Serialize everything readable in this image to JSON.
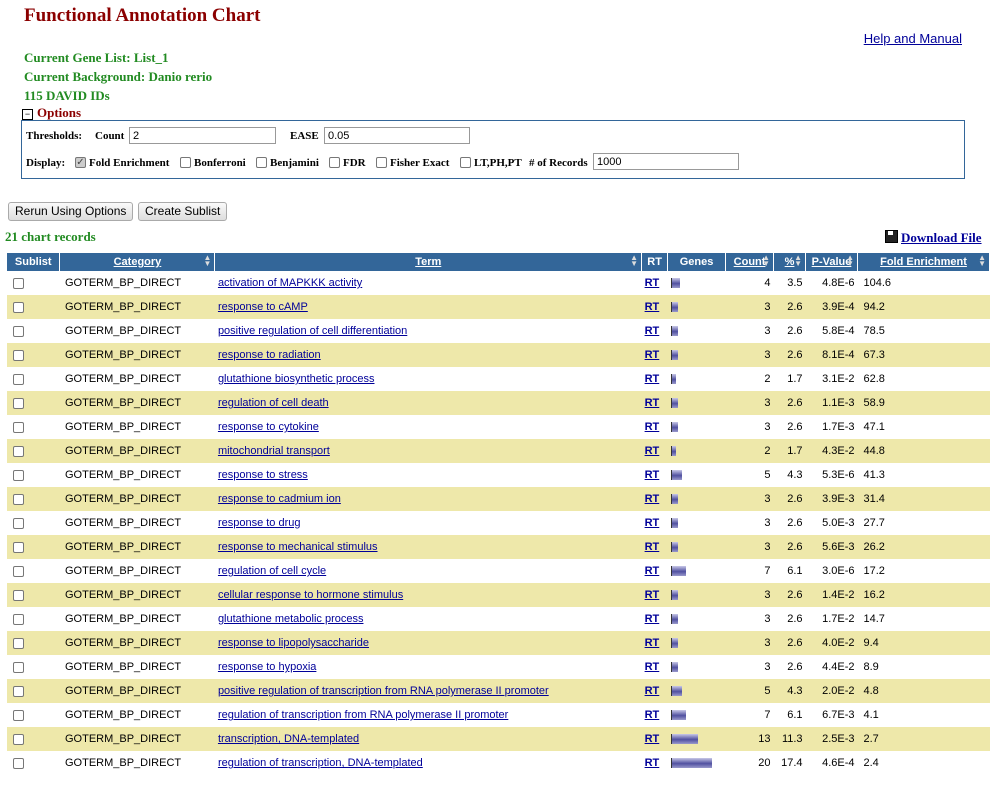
{
  "title": "Functional Annotation Chart",
  "help_link": "Help and Manual",
  "info": {
    "gene_list": "Current Gene List: List_1",
    "background": "Current Background: Danio rerio",
    "ids": "115 DAVID IDs"
  },
  "options": {
    "label": "Options",
    "toggle": "−",
    "thresholds_label": "Thresholds:",
    "count_label": "Count",
    "count_value": "2",
    "ease_label": "EASE",
    "ease_value": "0.05",
    "display_label": "Display:",
    "checks": [
      {
        "label": "Fold Enrichment",
        "checked": true
      },
      {
        "label": "Bonferroni",
        "checked": false
      },
      {
        "label": "Benjamini",
        "checked": false
      },
      {
        "label": "FDR",
        "checked": false
      },
      {
        "label": "Fisher Exact",
        "checked": false
      },
      {
        "label": "LT,PH,PT",
        "checked": false
      }
    ],
    "records_label": "# of Records",
    "records_value": "1000"
  },
  "buttons": {
    "rerun": "Rerun Using Options",
    "sublist": "Create Sublist"
  },
  "records_count": "21 chart records",
  "download": "Download File",
  "columns": [
    "Sublist",
    "Category",
    "Term",
    "RT",
    "Genes",
    "Count",
    "%",
    "P-Value",
    "Fold Enrichment"
  ],
  "rows": [
    {
      "category": "GOTERM_BP_DIRECT",
      "term": "activation of MAPKKK activity",
      "rt": "RT",
      "count": "4",
      "percent": "3.5",
      "pvalue": "4.8E-6",
      "fold": "104.6"
    },
    {
      "category": "GOTERM_BP_DIRECT",
      "term": "response to cAMP",
      "rt": "RT",
      "count": "3",
      "percent": "2.6",
      "pvalue": "3.9E-4",
      "fold": "94.2"
    },
    {
      "category": "GOTERM_BP_DIRECT",
      "term": "positive regulation of cell differentiation",
      "rt": "RT",
      "count": "3",
      "percent": "2.6",
      "pvalue": "5.8E-4",
      "fold": "78.5"
    },
    {
      "category": "GOTERM_BP_DIRECT",
      "term": "response to radiation",
      "rt": "RT",
      "count": "3",
      "percent": "2.6",
      "pvalue": "8.1E-4",
      "fold": "67.3"
    },
    {
      "category": "GOTERM_BP_DIRECT",
      "term": "glutathione biosynthetic process",
      "rt": "RT",
      "count": "2",
      "percent": "1.7",
      "pvalue": "3.1E-2",
      "fold": "62.8"
    },
    {
      "category": "GOTERM_BP_DIRECT",
      "term": "regulation of cell death",
      "rt": "RT",
      "count": "3",
      "percent": "2.6",
      "pvalue": "1.1E-3",
      "fold": "58.9"
    },
    {
      "category": "GOTERM_BP_DIRECT",
      "term": "response to cytokine",
      "rt": "RT",
      "count": "3",
      "percent": "2.6",
      "pvalue": "1.7E-3",
      "fold": "47.1"
    },
    {
      "category": "GOTERM_BP_DIRECT",
      "term": "mitochondrial transport",
      "rt": "RT",
      "count": "2",
      "percent": "1.7",
      "pvalue": "4.3E-2",
      "fold": "44.8"
    },
    {
      "category": "GOTERM_BP_DIRECT",
      "term": "response to stress",
      "rt": "RT",
      "count": "5",
      "percent": "4.3",
      "pvalue": "5.3E-6",
      "fold": "41.3"
    },
    {
      "category": "GOTERM_BP_DIRECT",
      "term": "response to cadmium ion",
      "rt": "RT",
      "count": "3",
      "percent": "2.6",
      "pvalue": "3.9E-3",
      "fold": "31.4"
    },
    {
      "category": "GOTERM_BP_DIRECT",
      "term": "response to drug",
      "rt": "RT",
      "count": "3",
      "percent": "2.6",
      "pvalue": "5.0E-3",
      "fold": "27.7"
    },
    {
      "category": "GOTERM_BP_DIRECT",
      "term": "response to mechanical stimulus",
      "rt": "RT",
      "count": "3",
      "percent": "2.6",
      "pvalue": "5.6E-3",
      "fold": "26.2"
    },
    {
      "category": "GOTERM_BP_DIRECT",
      "term": "regulation of cell cycle",
      "rt": "RT",
      "count": "7",
      "percent": "6.1",
      "pvalue": "3.0E-6",
      "fold": "17.2"
    },
    {
      "category": "GOTERM_BP_DIRECT",
      "term": "cellular response to hormone stimulus",
      "rt": "RT",
      "count": "3",
      "percent": "2.6",
      "pvalue": "1.4E-2",
      "fold": "16.2"
    },
    {
      "category": "GOTERM_BP_DIRECT",
      "term": "glutathione metabolic process",
      "rt": "RT",
      "count": "3",
      "percent": "2.6",
      "pvalue": "1.7E-2",
      "fold": "14.7"
    },
    {
      "category": "GOTERM_BP_DIRECT",
      "term": "response to lipopolysaccharide",
      "rt": "RT",
      "count": "3",
      "percent": "2.6",
      "pvalue": "4.0E-2",
      "fold": "9.4"
    },
    {
      "category": "GOTERM_BP_DIRECT",
      "term": "response to hypoxia",
      "rt": "RT",
      "count": "3",
      "percent": "2.6",
      "pvalue": "4.4E-2",
      "fold": "8.9"
    },
    {
      "category": "GOTERM_BP_DIRECT",
      "term": "positive regulation of transcription from RNA polymerase II promoter",
      "rt": "RT",
      "count": "5",
      "percent": "4.3",
      "pvalue": "2.0E-2",
      "fold": "4.8"
    },
    {
      "category": "GOTERM_BP_DIRECT",
      "term": "regulation of transcription from RNA polymerase II promoter",
      "rt": "RT",
      "count": "7",
      "percent": "6.1",
      "pvalue": "6.7E-3",
      "fold": "4.1"
    },
    {
      "category": "GOTERM_BP_DIRECT",
      "term": "transcription, DNA-templated",
      "rt": "RT",
      "count": "13",
      "percent": "11.3",
      "pvalue": "2.5E-3",
      "fold": "2.7"
    },
    {
      "category": "GOTERM_BP_DIRECT",
      "term": "regulation of transcription, DNA-templated",
      "rt": "RT",
      "count": "20",
      "percent": "17.4",
      "pvalue": "4.6E-4",
      "fold": "2.4"
    }
  ]
}
